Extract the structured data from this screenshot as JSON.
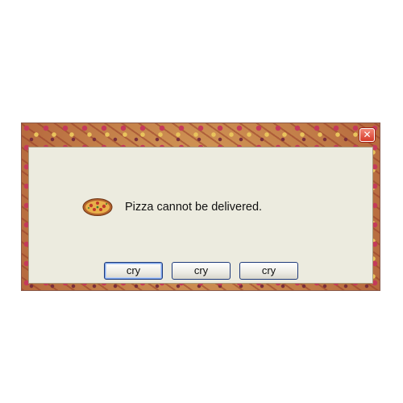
{
  "dialog": {
    "message": "Pizza cannot be delivered.",
    "icon": "pizza-icon",
    "close_glyph": "✕",
    "buttons": [
      {
        "label": "cry",
        "default": true
      },
      {
        "label": "cry",
        "default": false
      },
      {
        "label": "cry",
        "default": false
      }
    ]
  },
  "colors": {
    "client_background": "#ecebdf",
    "close_button": "#d73a2a",
    "button_border": "#1f3a7a"
  }
}
